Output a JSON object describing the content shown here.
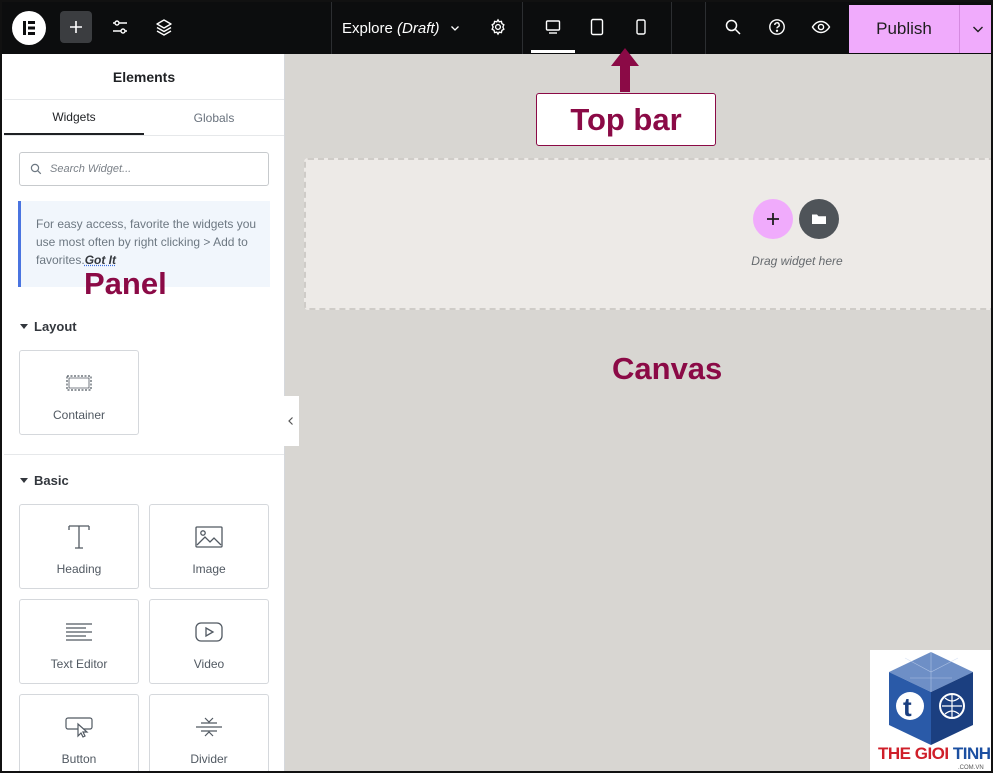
{
  "topbar": {
    "document_name": "Explore",
    "document_status": "(Draft)",
    "publish_label": "Publish",
    "icons": [
      "elementor-logo-icon",
      "plus-icon",
      "sliders-icon",
      "layers-icon",
      "chevron-down-icon",
      "gear-icon",
      "desktop-icon",
      "tablet-icon",
      "mobile-icon",
      "search-icon",
      "help-icon",
      "eye-icon"
    ]
  },
  "panel": {
    "title": "Elements",
    "tabs": [
      {
        "label": "Widgets",
        "active": true
      },
      {
        "label": "Globals",
        "active": false
      }
    ],
    "search_placeholder": "Search Widget...",
    "notice_text": "For easy access, favorite the widgets you use most often by right clicking > Add to favorites.",
    "notice_link": "Got It",
    "sections": [
      {
        "title": "Layout",
        "widgets": [
          {
            "label": "Container",
            "icon": "container-icon"
          }
        ]
      },
      {
        "title": "Basic",
        "widgets": [
          {
            "label": "Heading",
            "icon": "heading-icon"
          },
          {
            "label": "Image",
            "icon": "image-icon"
          },
          {
            "label": "Text Editor",
            "icon": "text-editor-icon"
          },
          {
            "label": "Video",
            "icon": "video-icon"
          },
          {
            "label": "Button",
            "icon": "button-icon"
          },
          {
            "label": "Divider",
            "icon": "divider-icon"
          }
        ]
      }
    ]
  },
  "canvas": {
    "drop_text": "Drag widget here"
  },
  "annotations": {
    "top_bar": "Top bar",
    "panel": "Panel",
    "canvas": "Canvas"
  },
  "watermark": {
    "line_red": "THE GIOI ",
    "line_blue": "TINHOC",
    "sub": ".COM.VN"
  },
  "colors": {
    "topbar_bg": "#0c0d0e",
    "publish_bg": "#f0abfc",
    "canvas_bg": "#d8d6d2",
    "annotation": "#8b0a46",
    "notice_accent": "#4a74e0"
  }
}
